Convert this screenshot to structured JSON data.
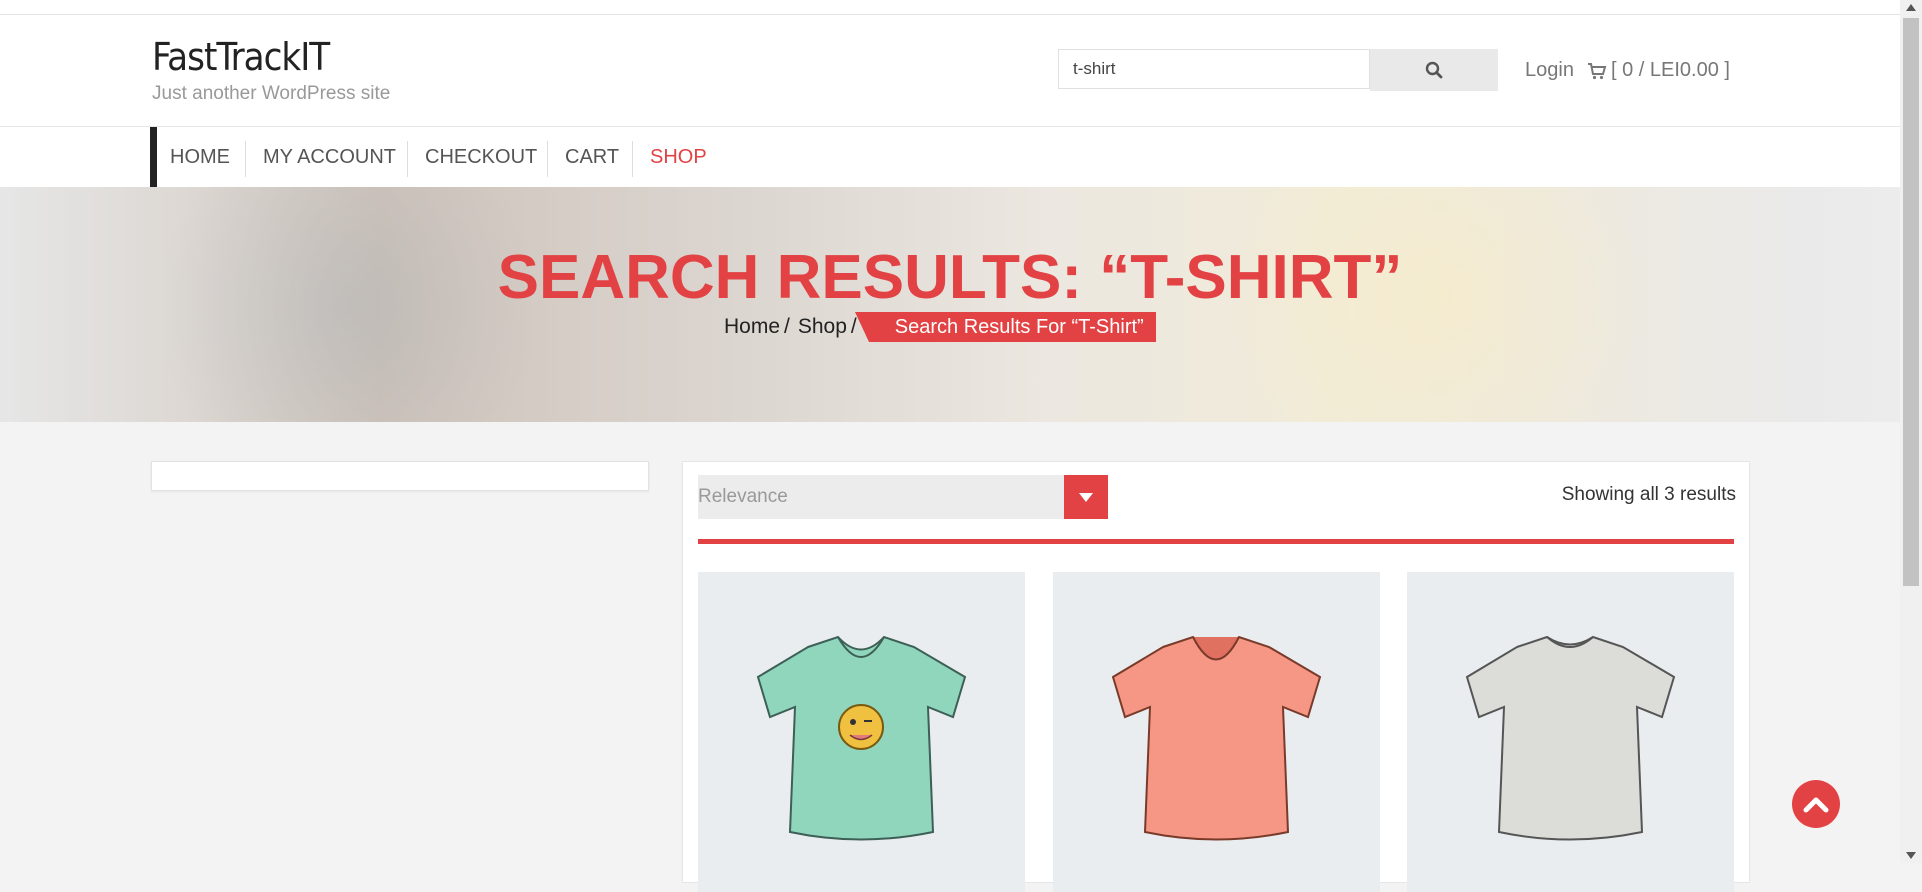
{
  "header": {
    "site_title": "FastTrackIT",
    "tagline": "Just another WordPress site",
    "search": {
      "value": "t-shirt"
    },
    "login_label": "Login",
    "cart_label": "[ 0 / LEI0.00 ]"
  },
  "nav": {
    "items": [
      {
        "label": "HOME"
      },
      {
        "label": "MY ACCOUNT"
      },
      {
        "label": "CHECKOUT"
      },
      {
        "label": "CART"
      },
      {
        "label": "SHOP",
        "active": true
      }
    ]
  },
  "hero": {
    "title": "SEARCH RESULTS: “T-SHIRT”",
    "breadcrumb": {
      "home": "Home",
      "shop": "Shop",
      "sep": "/",
      "current": "Search Results For “T-Shirt”"
    }
  },
  "shop": {
    "sort_selected": "Relevance",
    "result_count": "Showing all 3 results",
    "products": [
      {
        "color": "#8fd6bd",
        "name": "emoji-tshirt-image"
      },
      {
        "color": "#f59784",
        "name": "coral-tshirt-image"
      },
      {
        "color": "#dcdcd8",
        "name": "grey-tshirt-image"
      }
    ]
  },
  "colors": {
    "accent": "#e24243",
    "text": "#555555"
  }
}
